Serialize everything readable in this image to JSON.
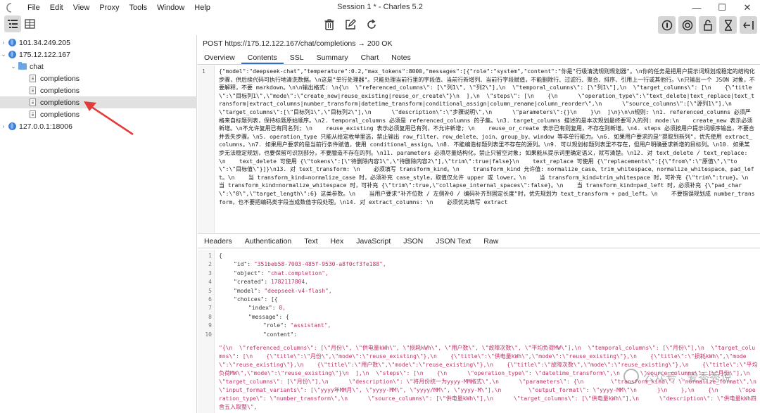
{
  "window": {
    "title": "Session 1 * - Charles 5.2",
    "controls": [
      "—",
      "☐",
      "✕"
    ]
  },
  "menu": [
    "File",
    "Edit",
    "View",
    "Proxy",
    "Tools",
    "Window",
    "Help"
  ],
  "tree": [
    {
      "label": "101.34.249.205",
      "type": "host",
      "expanded": false,
      "depth": 0
    },
    {
      "label": "175.12.122.167",
      "type": "host",
      "expanded": true,
      "depth": 0
    },
    {
      "label": "chat",
      "type": "folder",
      "expanded": true,
      "depth": 1
    },
    {
      "label": "completions",
      "type": "file",
      "depth": 2
    },
    {
      "label": "completions",
      "type": "file",
      "depth": 2
    },
    {
      "label": "completions",
      "type": "file",
      "depth": 2,
      "selected": true
    },
    {
      "label": "completions",
      "type": "file",
      "depth": 2
    },
    {
      "label": "127.0.0.1:18006",
      "type": "host",
      "expanded": false,
      "depth": 0
    }
  ],
  "request": {
    "line": "POST https://175.12.122.167/chat/completions → 200 OK",
    "tabs": [
      "Overview",
      "Contents",
      "SSL",
      "Summary",
      "Chart",
      "Notes"
    ],
    "active_tab": "Contents",
    "line_number": "1",
    "body": "{\"model\":\"deepseek-chat\",\"temperature\":0.2,\"max_tokens\":8000,\"messages\":[{\"role\":\"system\",\"content\":\"你是\"行级清洗规则规划器\"。\\n你的任务是把用户提示词规划成稳定的结构化步骤，供后续代码可执行地清洗数据。\\n这是\"单行处理器\"。只能处理当前行里的字段值、当前行新增列、当前行字段赋值，不能删除行、过滤行、聚合、排序、引用上一行或其他行。\\n只输出一个 JSON 对象，不要解释，不要 markdown。\\n\\n输出格式: \\n{\\n  \\\"referenced_columns\\\": [\\\"列1\\\", \\\"列2\\\"],\\n  \\\"temporal_columns\\\": [\\\"列1\\\"],\\n  \\\"target_columns\\\": [\\n    {\\\"title\\\":\\\"目标列1\\\",\\\"mode\\\":\\\"create_new|reuse_existing|reuse_or_create\\\"}\\n  ],\\n  \\\"steps\\\": [\\n    {\\n      \\\"operation_type\\\":\\\"text_delete|text_replace|text_transform|extract_columns|number_transform|datetime_transform|conditional_assign|column_rename|column_reorder\\\",\\n      \\\"source_columns\\\":[\\\"源列1\\\"],\\n      \\\"target_columns\\\":[\\\"目标列1\\\",\\\"目标列2\\\"],\\n      \\\"description\\\":\\\"步骤说明\\\",\\n      \\\"parameters\\\":{}\\n    }\\n  ]\\n}\\n\\n规则: \\n1. referenced_columns 必须严格来自标题列表，保持标题原始顺序。\\n2. temporal_columns 必须是 referenced_columns 的子集。\\n3. target_columns 描述的是本次规划最终要写入的列: mode:\\n    create_new 表示必须新增。\\n不允许复用已有同名列; \\n    reuse_existing 表示必须复用已有列，不允许新增; \\n    reuse_or_create 表示已有则复用，不存在则新增。\\n4. steps 必须按用户提示词顺序输出，不要合并丢失步骤。\\n5. operation_type 只能从给定枚举里选，禁止输出 row_filter、row_delete、join、group_by、window 等非单行能力。\\n6. 如果用户要求的是\"提取到新列\"，优先使用 extract_columns。\\n7. 如果用户要求的是当前行条件赋值，使用 conditional_assign。\\n8. 不能编造标题列表里不存在的源列。\\n9. 可以规划标题列表里不存在，但用户明确要求新增的目标列。\\n10. 如果某步无法稳定规划，也要保留可识别部分，不要臆造不存在的列。\\n11. parameters 必须尽量结构化，禁止只留空对象; 如果能从提示词里确定语义，就写清楚。\\n12. 对 text_delete / text_replace: \\n    text_delete 可使用 {\\\"tokens\\\":[\\\"待删除内容1\\\",\\\"待删除内容2\\\"],\\\"trim\\\":true|false}\\n    text_replace 可使用 {\\\"replacements\\\":[{\\\"from\\\":\\\"原值\\\",\\\"to\\\":\\\"目标值\\\"}]}\\n13. 对 text_transform: \\n    必须填写 transform_kind。\\n    transform_kind 允许值: normalize_case、trim_whitespace、normalize_whitespace、pad_left。\\n    当 transform_kind=normalize_case 时，必须补充 case_style，取值仅允许 upper 或 lower。\\n    当 transform_kind=trim_whitespace 时，可补充 {\\\"trim\\\":true}。\\n    当 transform_kind=normalize_whitespace 时，可补充 {\\\"trim\\\":true,\\\"collapse_internal_spaces\\\":false}。\\n    当 transform_kind=pad_left 时，必须补充 {\\\"pad_char\\\":\\\"0\\\",\\\"target_length\\\":6} 这类参数。\\n    当用户要求\"补齐位数 / 左侧补0 / 编码补齐到固定长度\"时，优先规划为 text_transform + pad_left。\\n    不要错误规划成 number_transform，也不要把编码类字段当成数值字段处理。\\n14. 对 extract_columns: \\n    必须优先填写 extract"
  },
  "response": {
    "tabs": [
      "Headers",
      "Authentication",
      "Text",
      "Hex",
      "JavaScript",
      "JSON",
      "JSON Text",
      "Raw"
    ],
    "active_tab": "Raw",
    "lines": [
      {
        "n": "1",
        "indent": 0,
        "key": "",
        "value": "{"
      },
      {
        "n": "2",
        "indent": 1,
        "key": "\"id\": ",
        "value": "\"351beb58-7003-485f-9530-a8f0cf3fe188\","
      },
      {
        "n": "3",
        "indent": 1,
        "key": "\"object\": ",
        "value": "\"chat.completion\","
      },
      {
        "n": "4",
        "indent": 1,
        "key": "\"created\": ",
        "value": "1782117804,"
      },
      {
        "n": "5",
        "indent": 1,
        "key": "\"model\": ",
        "value": "\"deepseek-v4-flash\","
      },
      {
        "n": "6",
        "indent": 1,
        "key": "\"choices\": ",
        "value": "[{"
      },
      {
        "n": "7",
        "indent": 2,
        "key": "\"index\": ",
        "value": "0,"
      },
      {
        "n": "8",
        "indent": 2,
        "key": "\"message\": ",
        "value": "{"
      },
      {
        "n": "9",
        "indent": 3,
        "key": "\"role\": ",
        "value": "\"assistant\","
      },
      {
        "n": "10",
        "indent": 3,
        "key": "\"content\": ",
        "value": ""
      }
    ],
    "content": "\"{\\n  \\\"referenced_columns\\\": [\\\"月份\\\", \\\"供电量kWh\\\", \\\"损耗kWh\\\", \\\"用户数\\\", \\\"故障次数\\\", \\\"平均负荷MW\\\"],\\n  \\\"temporal_columns\\\": [\\\"月份\\\"],\\n  \\\"target_columns\\\": [\\n    {\\\"title\\\":\\\"月份\\\",\\\"mode\\\":\\\"reuse_existing\\\"},\\n    {\\\"title\\\":\\\"供电量kWh\\\",\\\"mode\\\":\\\"reuse_existing\\\"},\\n    {\\\"title\\\":\\\"损耗kWh\\\",\\\"mode\\\":\\\"reuse_existing\\\"},\\n    {\\\"title\\\":\\\"用户数\\\",\\\"mode\\\":\\\"reuse_existing\\\"},\\n    {\\\"title\\\":\\\"故障次数\\\",\\\"mode\\\":\\\"reuse_existing\\\"},\\n    {\\\"title\\\":\\\"平均负荷MW\\\",\\\"mode\\\":\\\"reuse_existing\\\"}\\n  ],\\n  \\\"steps\\\": [\\n    {\\n      \\\"operation_type\\\": \\\"datetime_transform\\\",\\n      \\\"source_columns\\\": [\\\"月份\\\"],\\n      \\\"target_columns\\\": [\\\"月份\\\"],\\n      \\\"description\\\": \\\"将月份统一为yyyy-MM格式\\\",\\n      \\\"parameters\\\": {\\n        \\\"transform_kind\\\": \\\"normalize_format\\\",\\n        \\\"input_format_variants\\\": [\\\"yyyy年MM月\\\", \\\"yyyy-MM\\\", \\\"yyyy/MM\\\", \\\"yyyy-M\\\"],\\n        \\\"output_format\\\": \\\"yyyy-MM\\\"\\n      }\\n    },\\n    {\\n      \\\"operation_type\\\": \\\"number_transform\\\",\\n      \\\"source_columns\\\": [\\\"供电量kWh\\\"],\\n      \\\"target_columns\\\": [\\\"供电量kWh\\\"],\\n      \\\"description\\\": \\\"供电量kWh四舍五入取整\\\","
  },
  "watermark": "公众号 · 爱秀秀说"
}
